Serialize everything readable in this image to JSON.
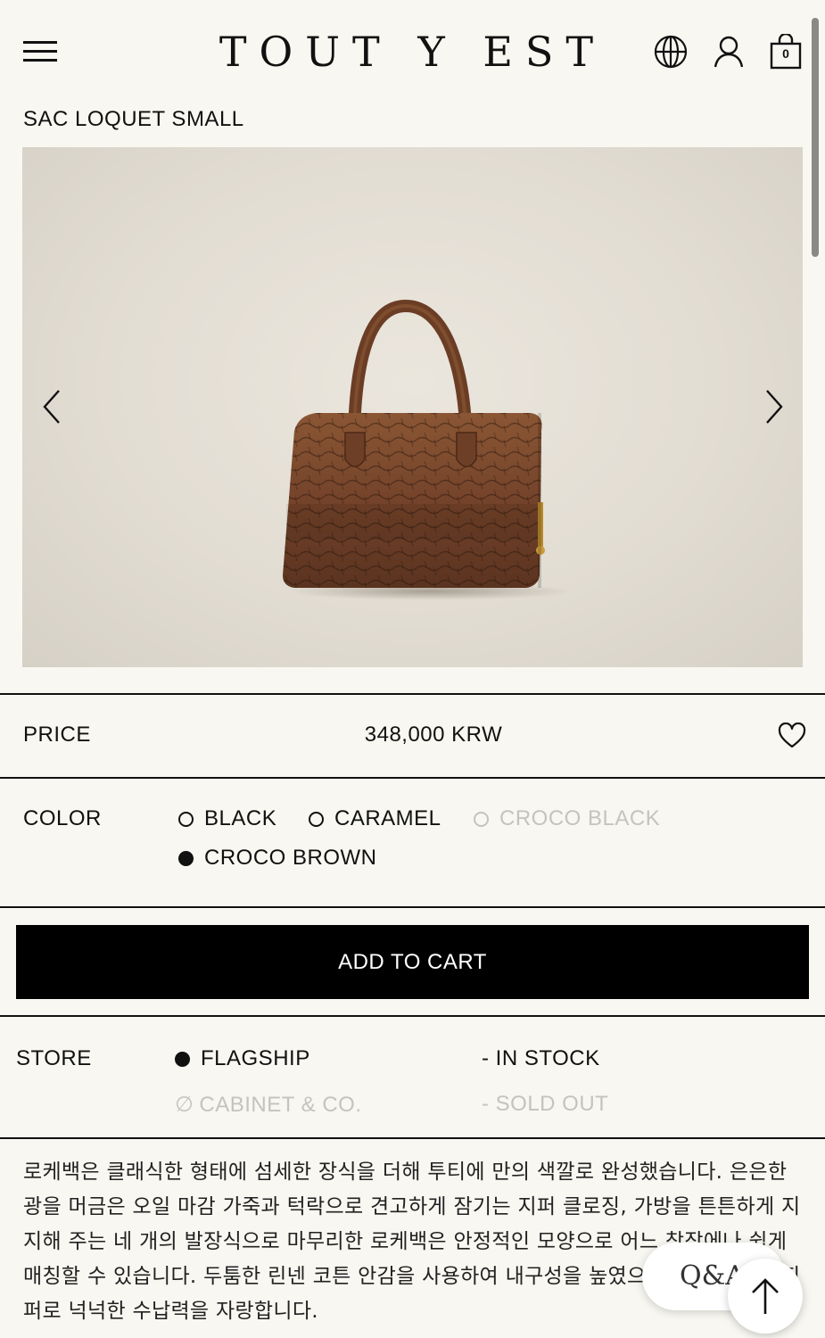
{
  "header": {
    "logo": "TOUT Y EST",
    "menu_icon": "hamburger-menu-icon",
    "language_icon": "globe-icon",
    "account_icon": "user-icon",
    "cart_icon": "shopping-bag-icon",
    "cart_count": "0"
  },
  "product": {
    "title": "SAC LOQUET SMALL",
    "image_subject": "brown croco-embossed leather top-handle bag",
    "gallery_prev_icon": "chevron-left-icon",
    "gallery_next_icon": "chevron-right-icon"
  },
  "price": {
    "label": "PRICE",
    "value": "348,000 KRW",
    "wishlist_icon": "heart-icon"
  },
  "color": {
    "label": "COLOR",
    "options": [
      {
        "label": "BLACK",
        "selected": false,
        "available": true
      },
      {
        "label": "CARAMEL",
        "selected": false,
        "available": true
      },
      {
        "label": "CROCO BLACK",
        "selected": false,
        "available": false
      },
      {
        "label": "CROCO BROWN",
        "selected": true,
        "available": true
      }
    ]
  },
  "cart_button": {
    "label": "ADD TO CART"
  },
  "store": {
    "label": "STORE",
    "rows": [
      {
        "name": "FLAGSHIP",
        "status": "-  IN STOCK",
        "available": true
      },
      {
        "name": "CABINET & CO.",
        "status": "-  SOLD OUT",
        "available": false
      }
    ]
  },
  "description": "로케백은 클래식한 형태에 섬세한 장식을 더해 투티에 만의 색깔로 완성했습니다. 은은한 광을 머금은 오일 마감 가죽과 턱락으로 견고하게 잠기는 지퍼 클로징, 가방을 튼튼하게 지지해 주는 네 개의 발장식으로 마무리한 로케백은 안정적인 모양으로 어느 착장에나 쉽게 매칭할 수 있습니다. 두툼한 린넨 코튼 안감을 사용하여 내구성을 높였으며 넓게 열리는 지퍼로 넉넉한 수납력을 자랑합니다.",
  "floating": {
    "qa_label": "Q&A",
    "top_icon": "arrow-up-icon"
  },
  "colors": {
    "background": "#f8f7f1",
    "text": "#111111",
    "disabled": "#c4c3bd",
    "button": "#000000"
  }
}
